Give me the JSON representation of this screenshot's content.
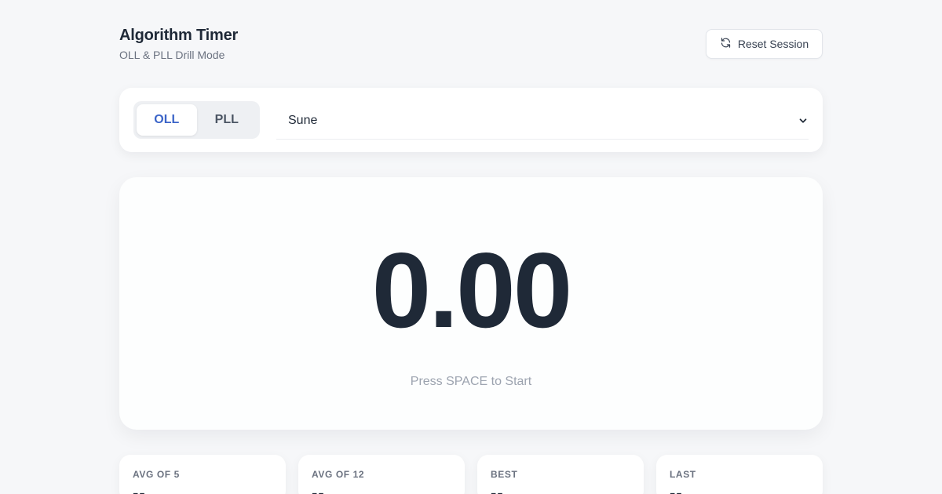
{
  "header": {
    "title": "Algorithm Timer",
    "subtitle": "OLL & PLL Drill Mode",
    "reset_label": "Reset Session"
  },
  "controls": {
    "modes": [
      {
        "label": "OLL",
        "active": true
      },
      {
        "label": "PLL",
        "active": false
      }
    ],
    "selected_algorithm": "Sune"
  },
  "timer": {
    "value": "0.00",
    "hint": "Press SPACE to Start"
  },
  "stats": [
    {
      "label": "AVG OF 5",
      "value": "--"
    },
    {
      "label": "AVG OF 12",
      "value": "--"
    },
    {
      "label": "BEST",
      "value": "--"
    },
    {
      "label": "LAST",
      "value": "--"
    }
  ],
  "icons": {
    "reset": "refresh-icon",
    "select": "chevron-down-icon"
  },
  "colors": {
    "accent": "#3b64c8",
    "background": "#f6f7f9",
    "text": "#1f2937",
    "muted": "#9ca3af"
  }
}
